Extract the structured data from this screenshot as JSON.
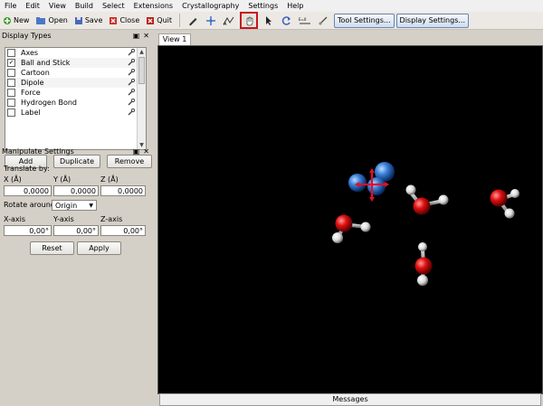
{
  "menu": [
    "File",
    "Edit",
    "View",
    "Build",
    "Select",
    "Extensions",
    "Crystallography",
    "Settings",
    "Help"
  ],
  "toolbar": {
    "new_label": "New",
    "open_label": "Open",
    "save_label": "Save",
    "close_label": "Close",
    "quit_label": "Quit",
    "tool_settings_label": "Tool Settings...",
    "display_settings_label": "Display Settings..."
  },
  "display_types": {
    "title": "Display Types",
    "items": [
      {
        "label": "Axes",
        "checked": false
      },
      {
        "label": "Ball and Stick",
        "checked": true
      },
      {
        "label": "Cartoon",
        "checked": false
      },
      {
        "label": "Dipole",
        "checked": false
      },
      {
        "label": "Force",
        "checked": false
      },
      {
        "label": "Hydrogen Bond",
        "checked": false
      },
      {
        "label": "Label",
        "checked": false
      }
    ],
    "add_label": "Add",
    "duplicate_label": "Duplicate",
    "remove_label": "Remove"
  },
  "manipulate": {
    "title": "Manipulate Settings",
    "translate_by": "Translate by:",
    "x_label": "X (Å)",
    "y_label": "Y (Å)",
    "z_label": "Z (Å)",
    "x_value": "0,0000",
    "y_value": "0,0000",
    "z_value": "0,0000",
    "rotate_around_label": "Rotate around:",
    "rotate_around_value": "Origin",
    "x_axis_label": "X-axis",
    "y_axis_label": "Y-axis",
    "z_axis_label": "Z-axis",
    "x_axis_value": "0,00°",
    "y_axis_value": "0,00°",
    "z_axis_value": "0,00°",
    "reset_label": "Reset",
    "apply_label": "Apply"
  },
  "view": {
    "tab_label": "View 1",
    "messages_label": "Messages"
  },
  "colors": {
    "oxygen": "#e01010",
    "hydrogen": "#e8e8e8",
    "nitrogen": "#3a7fd8",
    "manipulator": "#e0102a",
    "highlight": "#c8141e"
  }
}
